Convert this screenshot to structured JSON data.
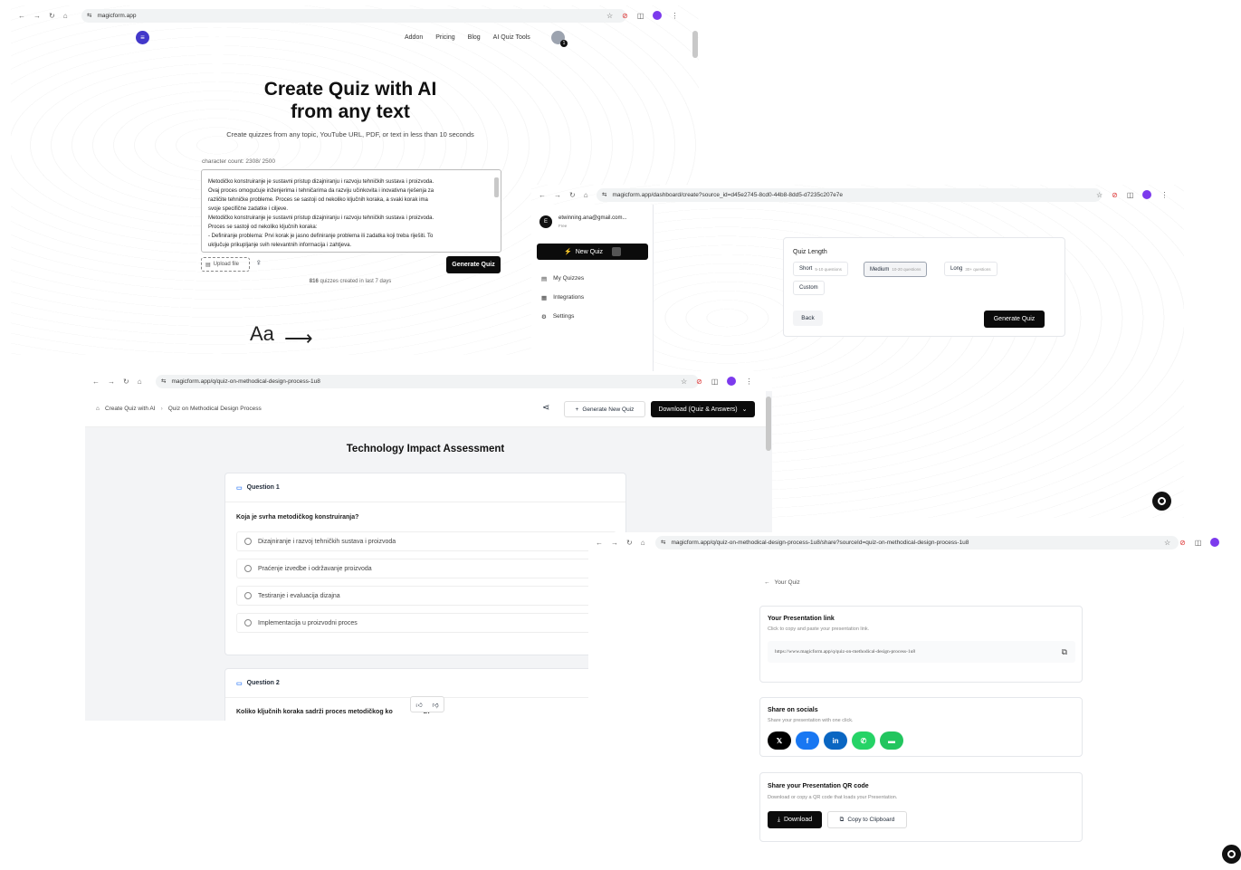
{
  "s1": {
    "url": "magicform.app",
    "nav": [
      "Addon",
      "Pricing",
      "Blog",
      "AI Quiz Tools"
    ],
    "title1": "Create Quiz with AI",
    "title2": "from any text",
    "subtitle": "Create quizzes from any topic, YouTube URL, PDF, or text in less than 10 seconds",
    "char_count": "character count: 2308/ 2500",
    "text_lines": [
      "Metodičko konstruiranje je sustavni pristup dizajniranju i razvoju tehničkih sustava i proizvoda.",
      "Ovaj proces omogućuje inženjerima i tehničarima da razviju učinkovita i inovativna rješenja za",
      "različite tehničke probleme. Proces se sastoji od nekoliko ključnih koraka, a svaki korak ima",
      "svoje specifične zadatke i ciljeve.",
      "Metodičko konstruiranje je sustavni pristup dizajniranju i razvoju tehničkih sustava i proizvoda.",
      "Proces se sastoji od nekoliko ključnih koraka:",
      "- Definiranje problema: Prvi korak je jasno definiranje problema ili zadatka koji treba riješiti. To",
      "uključuje prikupljanje svih relevantnih informacija i zahtjeva."
    ],
    "upload_label": "Upload file",
    "generate_label": "Generate Quiz",
    "stats_count": "816",
    "stats_text": "quizzes created in last 7 days",
    "font_glyph": "Aa",
    "badge": "1"
  },
  "s2": {
    "url": "magicform.app/dashboard/create?source_id=d45e2745-8cd0-44b8-8dd5-d7235c207e7e",
    "avatar_letter": "E",
    "email": "etwinning.ana@gmail.com...",
    "plan": "Free",
    "new_quiz": "New Quiz",
    "menu": [
      "My Quizzes",
      "Integrations",
      "Settings"
    ],
    "quiz_length_label": "Quiz Length",
    "lengths": [
      {
        "name": "Short",
        "range": "5-10 questions"
      },
      {
        "name": "Medium",
        "range": "10-20 questions"
      },
      {
        "name": "Long",
        "range": "30+ questions"
      }
    ],
    "custom": "Custom",
    "back": "Back",
    "generate": "Generate Quiz"
  },
  "s3": {
    "url": "magicform.app/q/quiz-on-methodical-design-process-1u8",
    "crumb1": "Create Quiz with AI",
    "crumb2": "Quiz on Methodical Design Process",
    "new_quiz": "Generate New Quiz",
    "download": "Download (Quiz & Answers)",
    "heading": "Technology Impact Assessment",
    "q1_label": "Question 1",
    "q1_text": "Koja je svrha metodičkog konstruiranja?",
    "options": [
      "Dizajniranje i razvoj tehničkih sustava i proizvoda",
      "Praćenje izvedbe i održavanje proizvoda",
      "Testiranje i evaluacija dizajna",
      "Implementacija u proizvodni proces"
    ],
    "q2_label": "Question 2",
    "q2_text_a": "Koliko ključnih koraka sadrži proces metodičkog ko",
    "q2_text_b": "a?"
  },
  "s4": {
    "url": "magicform.app/q/quiz-on-methodical-design-process-1u8/share?sourceId=quiz-on-methodical-design-process-1u8",
    "back": "Your Quiz",
    "link_title": "Your Presentation link",
    "link_sub": "Click to copy and paste your presentation link.",
    "link_value": "https://www.magicform.app/q/quiz-on-methodical-design-process-1u8",
    "socials_title": "Share on socials",
    "socials_sub": "Share your presentation with one click.",
    "qr_title": "Share your Presentation QR code",
    "qr_sub": "Download or copy a QR code that loads your Presentation.",
    "download": "Download",
    "copy": "Copy to Clipboard"
  },
  "colors": {
    "x": "#000000",
    "facebook": "#1877f2",
    "linkedin": "#0a66c2",
    "whatsapp": "#25d366",
    "message": "#22c55e"
  }
}
